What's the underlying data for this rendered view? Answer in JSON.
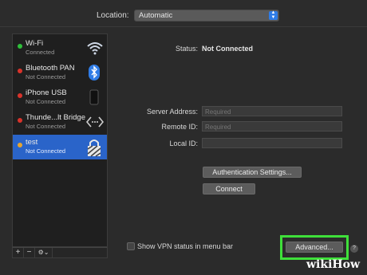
{
  "header": {
    "location_label": "Location:",
    "location_value": "Automatic"
  },
  "sidebar": {
    "items": [
      {
        "name": "Wi-Fi",
        "status": "Connected",
        "dot_color": "#2fbf3a",
        "icon": "wifi-icon"
      },
      {
        "name": "Bluetooth PAN",
        "status": "Not Connected",
        "dot_color": "#d9332b",
        "icon": "bluetooth-icon"
      },
      {
        "name": "iPhone USB",
        "status": "Not Connected",
        "dot_color": "#d9332b",
        "icon": "iphone-icon"
      },
      {
        "name": "Thunde...lt Bridge",
        "status": "Not Connected",
        "dot_color": "#d9332b",
        "icon": "thunderbolt-bridge-icon"
      },
      {
        "name": "test",
        "status": "Not Connected",
        "dot_color": "#e6a530",
        "icon": "vpn-lock-icon",
        "selected": true
      }
    ],
    "toolbar": {
      "add": "+",
      "remove": "−",
      "action": "⚙⌄"
    }
  },
  "main": {
    "status_label": "Status:",
    "status_value": "Not Connected",
    "server_address_label": "Server Address:",
    "server_address_placeholder": "Required",
    "remote_id_label": "Remote ID:",
    "remote_id_placeholder": "Required",
    "local_id_label": "Local ID:",
    "local_id_value": "",
    "auth_settings_button": "Authentication Settings...",
    "connect_button": "Connect",
    "show_vpn_status_label": "Show VPN status in menu bar",
    "show_vpn_status_checked": false,
    "advanced_button": "Advanced...",
    "help_button": "?"
  },
  "watermark": {
    "part1": "wiki",
    "part2": "How"
  },
  "colors": {
    "selection": "#2a64c9",
    "highlight": "#3fe03a",
    "accent": "#2f7ce6"
  }
}
